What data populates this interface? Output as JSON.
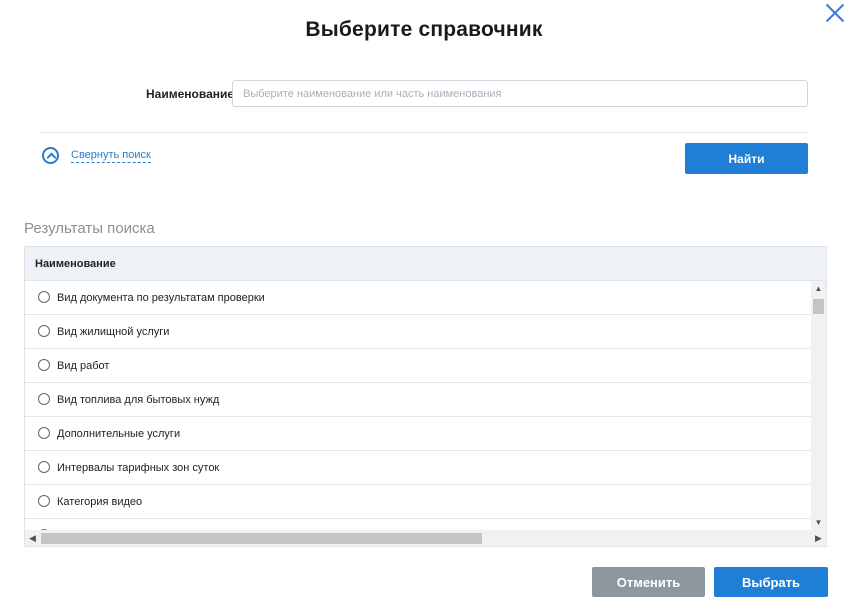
{
  "dialog": {
    "title": "Выберите справочник",
    "close_icon": "close-icon"
  },
  "search": {
    "name_label": "Наименование",
    "name_value": "",
    "name_placeholder": "Выберите наименование или часть наименования",
    "collapse_label": "Свернуть поиск",
    "collapse_icon": "chevron-up-circle-icon",
    "find_label": "Найти"
  },
  "results": {
    "title": "Результаты поиска",
    "column_header": "Наименование",
    "rows": [
      "Вид документа по результатам проверки",
      "Вид жилищной услуги",
      "Вид работ",
      "Вид топлива для бытовых нужд",
      "Дополнительные услуги",
      "Интервалы тарифных зон суток",
      "Категория видео"
    ]
  },
  "footer": {
    "cancel_label": "Отменить",
    "select_label": "Выбрать"
  },
  "colors": {
    "primary": "#1f7fd6",
    "secondary": "#8c979f",
    "link": "#2b7bc9"
  }
}
